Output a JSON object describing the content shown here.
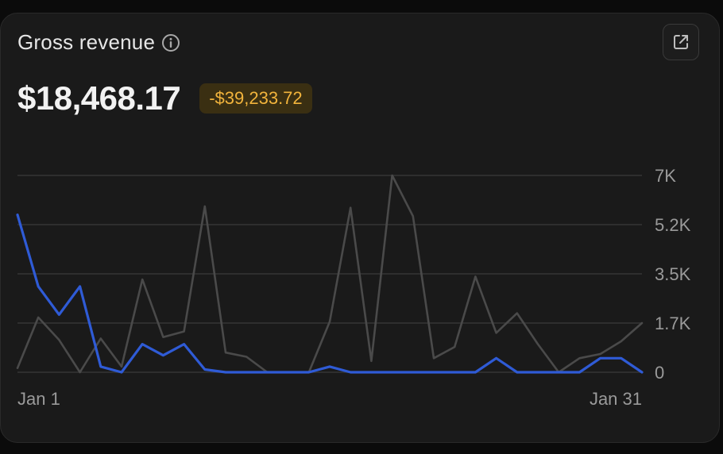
{
  "card": {
    "title": "Gross revenue",
    "amount": "$18,468.17",
    "delta": "-$39,233.72"
  },
  "colors": {
    "current_series": "#2f5bd6",
    "previous_series": "#4a4a4a",
    "delta_text": "#f2b43c",
    "delta_bg": "#3a2f12"
  },
  "icons": {
    "info": "info-circle-icon",
    "external": "external-link-icon"
  },
  "chart_data": {
    "type": "line",
    "ylim": [
      0,
      7000
    ],
    "y_ticks": [
      {
        "value": 0,
        "label": "0"
      },
      {
        "value": 1750,
        "label": "1.7K"
      },
      {
        "value": 3500,
        "label": "3.5K"
      },
      {
        "value": 5250,
        "label": "5.2K"
      },
      {
        "value": 7000,
        "label": "7K"
      }
    ],
    "x_tick_labels": [
      "Jan 1",
      "Jan 31"
    ],
    "x_range": [
      1,
      31
    ],
    "grid": true,
    "series": [
      {
        "role": "previous",
        "values": [
          150,
          1950,
          1150,
          0,
          1200,
          200,
          3300,
          1250,
          1450,
          5900,
          700,
          550,
          0,
          0,
          0,
          1800,
          5850,
          400,
          7000,
          5550,
          500,
          900,
          3400,
          1400,
          2100,
          1000,
          0,
          500,
          650,
          1100,
          1750
        ]
      },
      {
        "role": "current",
        "values": [
          5600,
          3050,
          2050,
          3050,
          200,
          0,
          1000,
          600,
          1000,
          100,
          0,
          0,
          0,
          0,
          0,
          200,
          0,
          0,
          0,
          0,
          0,
          0,
          0,
          500,
          0,
          0,
          0,
          0,
          500,
          500,
          0
        ]
      }
    ]
  }
}
